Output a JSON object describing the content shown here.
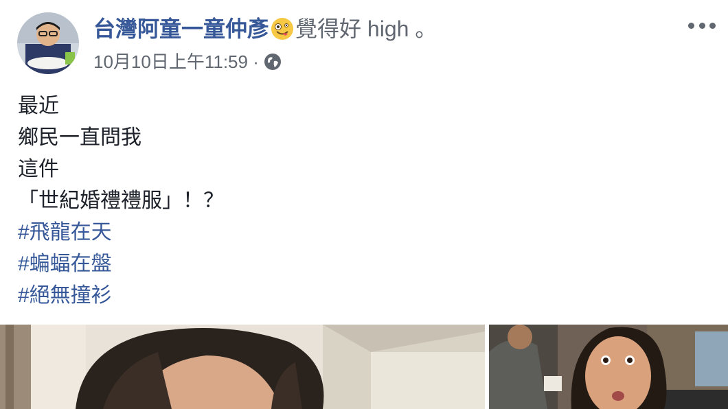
{
  "post": {
    "author_name": "台灣阿童一童仲彥",
    "feeling_text": "覺得好 high 。",
    "timestamp": "10月10日上午11:59",
    "separator": "·",
    "privacy_icon": "globe-icon",
    "more_icon": "more-options-icon",
    "lines": [
      "最近",
      "鄉民一直問我",
      "這件",
      "「世紀婚禮禮服」！？"
    ],
    "hashtags": [
      "#飛龍在天",
      "#蝙蝠在盤",
      "#絕無撞衫"
    ]
  },
  "colors": {
    "link": "#365899",
    "meta": "#616770",
    "text": "#1d2129"
  }
}
